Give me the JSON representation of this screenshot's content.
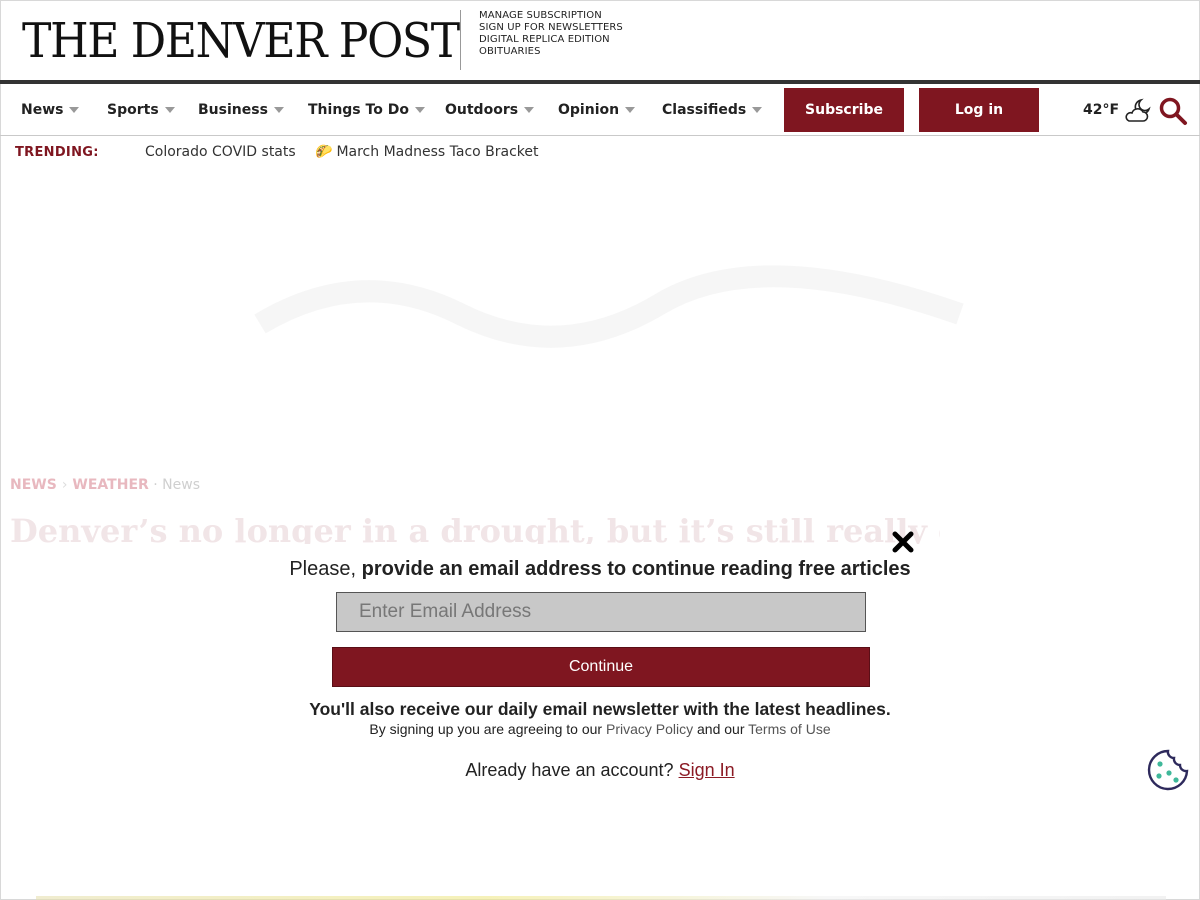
{
  "header": {
    "logo_text": "THE DENVER POST",
    "utility_links": [
      "MANAGE SUBSCRIPTION",
      "SIGN UP FOR NEWSLETTERS",
      "DIGITAL REPLICA EDITION",
      "OBITUARIES"
    ]
  },
  "nav": {
    "items": [
      "News",
      "Sports",
      "Business",
      "Things To Do",
      "Outdoors",
      "Opinion",
      "Classifieds"
    ],
    "subscribe_label": "Subscribe",
    "login_label": "Log in",
    "weather_temp": "42°F",
    "weather_icon": "partly-cloudy-night-icon",
    "search_icon": "search-icon"
  },
  "trending": {
    "label": "TRENDING:",
    "links": [
      "Colorado COVID stats",
      "March Madness Taco Bracket"
    ],
    "taco_emoji": "🌮"
  },
  "article": {
    "breadcrumb_section": "NEWS",
    "breadcrumb_subsection": "WEATHER",
    "breadcrumb_tag": "News",
    "headline": "Denver’s no longer in a drought, but it’s still really dry"
  },
  "modal": {
    "heading_prefix": "Please,",
    "heading_bold": "provide an email address to continue reading free articles",
    "email_placeholder": "Enter Email Address",
    "continue_label": "Continue",
    "newsletter_note": "You'll also receive our daily email newsletter with the latest headlines.",
    "terms_prefix": "By signing up you are agreeing to our",
    "privacy_label": "Privacy Policy",
    "terms_and": "and our",
    "terms_label": "Terms of Use",
    "signin_prefix": "Already have an account?",
    "signin_label": "Sign In"
  },
  "colors": {
    "brand_red": "#7f1620",
    "link_red": "#8b1a24",
    "cookie_outline": "#2e2a5c",
    "cookie_dots": "#3fb89a"
  }
}
